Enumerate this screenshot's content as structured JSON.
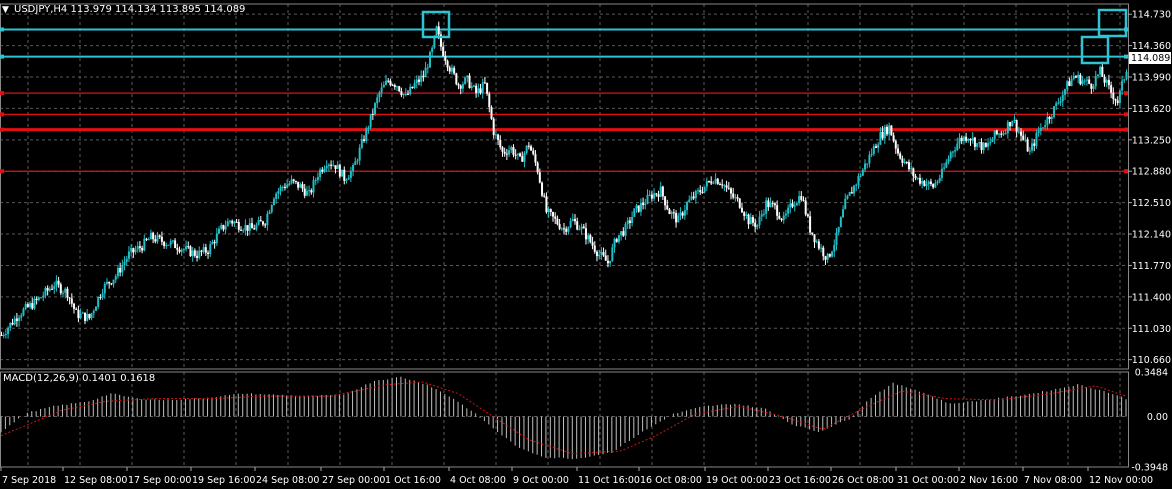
{
  "symbol_header": "USDJPY,H4  113.979 114.134 113.895 114.089",
  "macd_header": "MACD(12,26,9) 0.1401 0.1618",
  "current_price_label": "114.089",
  "colors": {
    "background": "#000000",
    "grid": "#5a5a5a",
    "bull_candle": "#21c0c8",
    "bear_candle": "#ffffff",
    "resistance_line": "#2ec4d4",
    "support_line": "#e01010",
    "macd_hist": "#c0c0c0",
    "macd_signal": "#e01010",
    "highlight_box": "#2ec4d4"
  },
  "chart_data": [
    {
      "type": "candlestick",
      "title": "USDJPY,H4",
      "ylim": [
        110.55,
        114.85
      ],
      "y_ticks": [
        "114.730",
        "114.360",
        "113.990",
        "113.620",
        "113.250",
        "112.880",
        "112.510",
        "112.140",
        "111.770",
        "111.400",
        "111.030",
        "110.660"
      ],
      "x_ticks": [
        "7 Sep 2018",
        "12 Sep 08:00",
        "17 Sep 00:00",
        "19 Sep 16:00",
        "24 Sep 08:00",
        "27 Sep 00:00",
        "1 Oct 16:00",
        "4 Oct 08:00",
        "9 Oct 00:00",
        "11 Oct 16:00",
        "16 Oct 08:00",
        "19 Oct 00:00",
        "23 Oct 16:00",
        "26 Oct 08:00",
        "31 Oct 00:00",
        "2 Nov 16:00",
        "7 Nov 08:00",
        "12 Nov 00:00"
      ],
      "grid": true,
      "horizontal_lines": [
        {
          "price": 114.55,
          "style": "resistance"
        },
        {
          "price": 114.23,
          "style": "resistance"
        },
        {
          "price": 113.8,
          "style": "support-thin"
        },
        {
          "price": 113.55,
          "style": "support-thin"
        },
        {
          "price": 113.37,
          "style": "support-thick"
        },
        {
          "price": 112.88,
          "style": "support-thin"
        }
      ],
      "series": [
        {
          "close_path": [
            [
              0,
              110.95
            ],
            [
              8,
              111.2
            ],
            [
              16,
              111.35
            ],
            [
              24,
              111.55
            ],
            [
              30,
              111.45
            ],
            [
              34,
              111.2
            ],
            [
              40,
              111.15
            ],
            [
              46,
              111.5
            ],
            [
              52,
              111.65
            ],
            [
              58,
              111.9
            ],
            [
              64,
              112.0
            ],
            [
              68,
              112.1
            ],
            [
              74,
              112.05
            ],
            [
              80,
              112.0
            ],
            [
              84,
              111.95
            ],
            [
              89,
              111.9
            ],
            [
              94,
              111.95
            ],
            [
              100,
              112.2
            ],
            [
              104,
              112.3
            ],
            [
              108,
              112.25
            ],
            [
              114,
              112.2
            ],
            [
              120,
              112.3
            ],
            [
              124,
              112.6
            ],
            [
              128,
              112.7
            ],
            [
              132,
              112.75
            ],
            [
              136,
              112.7
            ],
            [
              140,
              112.6
            ],
            [
              144,
              112.85
            ],
            [
              148,
              113.0
            ],
            [
              152,
              112.95
            ],
            [
              156,
              112.8
            ],
            [
              160,
              112.9
            ],
            [
              164,
              113.2
            ],
            [
              168,
              113.5
            ],
            [
              172,
              113.8
            ],
            [
              176,
              113.95
            ],
            [
              180,
              113.9
            ],
            [
              184,
              113.75
            ],
            [
              188,
              113.9
            ],
            [
              192,
              114.0
            ],
            [
              196,
              114.3
            ],
            [
              198,
              114.55
            ],
            [
              200,
              114.35
            ],
            [
              204,
              114.1
            ],
            [
              208,
              113.9
            ],
            [
              212,
              113.95
            ],
            [
              216,
              113.8
            ],
            [
              220,
              113.9
            ],
            [
              224,
              113.35
            ],
            [
              228,
              113.1
            ],
            [
              232,
              113.15
            ],
            [
              236,
              113.0
            ],
            [
              240,
              113.2
            ],
            [
              244,
              112.9
            ],
            [
              248,
              112.4
            ],
            [
              252,
              112.3
            ],
            [
              256,
              112.2
            ],
            [
              260,
              112.3
            ],
            [
              264,
              112.2
            ],
            [
              268,
              112.05
            ],
            [
              272,
              111.9
            ],
            [
              276,
              111.8
            ],
            [
              280,
              112.1
            ],
            [
              284,
              112.2
            ],
            [
              288,
              112.4
            ],
            [
              292,
              112.5
            ],
            [
              296,
              112.6
            ],
            [
              300,
              112.65
            ],
            [
              304,
              112.4
            ],
            [
              308,
              112.3
            ],
            [
              312,
              112.5
            ],
            [
              316,
              112.6
            ],
            [
              320,
              112.7
            ],
            [
              324,
              112.8
            ],
            [
              328,
              112.75
            ],
            [
              332,
              112.6
            ],
            [
              336,
              112.5
            ],
            [
              340,
              112.3
            ],
            [
              344,
              112.25
            ],
            [
              348,
              112.5
            ],
            [
              352,
              112.45
            ],
            [
              356,
              112.3
            ],
            [
              360,
              112.5
            ],
            [
              364,
              112.6
            ],
            [
              368,
              112.2
            ],
            [
              372,
              112.0
            ],
            [
              376,
              111.85
            ],
            [
              380,
              112.1
            ],
            [
              384,
              112.5
            ],
            [
              388,
              112.7
            ],
            [
              392,
              112.9
            ],
            [
              396,
              113.1
            ],
            [
              400,
              113.3
            ],
            [
              404,
              113.4
            ],
            [
              408,
              113.1
            ],
            [
              412,
              112.95
            ],
            [
              416,
              112.8
            ],
            [
              420,
              112.75
            ],
            [
              424,
              112.7
            ],
            [
              428,
              112.85
            ],
            [
              432,
              113.1
            ],
            [
              436,
              113.25
            ],
            [
              440,
              113.3
            ],
            [
              444,
              113.2
            ],
            [
              448,
              113.15
            ],
            [
              452,
              113.3
            ],
            [
              456,
              113.35
            ],
            [
              460,
              113.5
            ],
            [
              464,
              113.3
            ],
            [
              468,
              113.1
            ],
            [
              472,
              113.35
            ],
            [
              476,
              113.5
            ],
            [
              480,
              113.65
            ],
            [
              484,
              113.85
            ],
            [
              488,
              114.0
            ],
            [
              492,
              113.95
            ],
            [
              496,
              113.9
            ],
            [
              500,
              114.05
            ],
            [
              504,
              113.85
            ],
            [
              508,
              113.7
            ],
            [
              512,
              114.09
            ]
          ]
        }
      ]
    },
    {
      "type": "bar",
      "title": "MACD(12,26,9) 0.1401 0.1618",
      "ylim": [
        -0.3948,
        0.3484
      ],
      "y_ticks": [
        "0.3484",
        "0.00",
        "-0.3948"
      ],
      "series": [
        {
          "name": "MACD",
          "keypoints": [
            [
              0,
              -0.12
            ],
            [
              12,
              0.03
            ],
            [
              24,
              0.08
            ],
            [
              40,
              0.12
            ],
            [
              50,
              0.18
            ],
            [
              62,
              0.14
            ],
            [
              74,
              0.13
            ],
            [
              90,
              0.14
            ],
            [
              110,
              0.18
            ],
            [
              126,
              0.17
            ],
            [
              140,
              0.16
            ],
            [
              156,
              0.17
            ],
            [
              170,
              0.28
            ],
            [
              182,
              0.31
            ],
            [
              194,
              0.25
            ],
            [
              206,
              0.14
            ],
            [
              216,
              0.02
            ],
            [
              226,
              -0.12
            ],
            [
              236,
              -0.25
            ],
            [
              248,
              -0.32
            ],
            [
              262,
              -0.33
            ],
            [
              278,
              -0.28
            ],
            [
              292,
              -0.12
            ],
            [
              306,
              0.02
            ],
            [
              320,
              0.08
            ],
            [
              334,
              0.1
            ],
            [
              348,
              0.06
            ],
            [
              360,
              -0.06
            ],
            [
              372,
              -0.12
            ],
            [
              386,
              -0.02
            ],
            [
              396,
              0.15
            ],
            [
              406,
              0.26
            ],
            [
              418,
              0.2
            ],
            [
              432,
              0.1
            ],
            [
              448,
              0.13
            ],
            [
              462,
              0.16
            ],
            [
              476,
              0.2
            ],
            [
              490,
              0.25
            ],
            [
              502,
              0.2
            ],
            [
              512,
              0.14
            ]
          ]
        },
        {
          "name": "Signal",
          "keypoints": [
            [
              0,
              -0.15
            ],
            [
              14,
              -0.05
            ],
            [
              28,
              0.05
            ],
            [
              48,
              0.12
            ],
            [
              70,
              0.14
            ],
            [
              96,
              0.14
            ],
            [
              120,
              0.16
            ],
            [
              150,
              0.16
            ],
            [
              176,
              0.25
            ],
            [
              192,
              0.27
            ],
            [
              208,
              0.18
            ],
            [
              224,
              0.0
            ],
            [
              240,
              -0.18
            ],
            [
              260,
              -0.29
            ],
            [
              282,
              -0.27
            ],
            [
              298,
              -0.15
            ],
            [
              316,
              0.02
            ],
            [
              336,
              0.08
            ],
            [
              356,
              0.0
            ],
            [
              374,
              -0.1
            ],
            [
              392,
              0.06
            ],
            [
              410,
              0.2
            ],
            [
              430,
              0.14
            ],
            [
              454,
              0.13
            ],
            [
              478,
              0.18
            ],
            [
              498,
              0.24
            ],
            [
              512,
              0.16
            ]
          ]
        }
      ]
    }
  ]
}
